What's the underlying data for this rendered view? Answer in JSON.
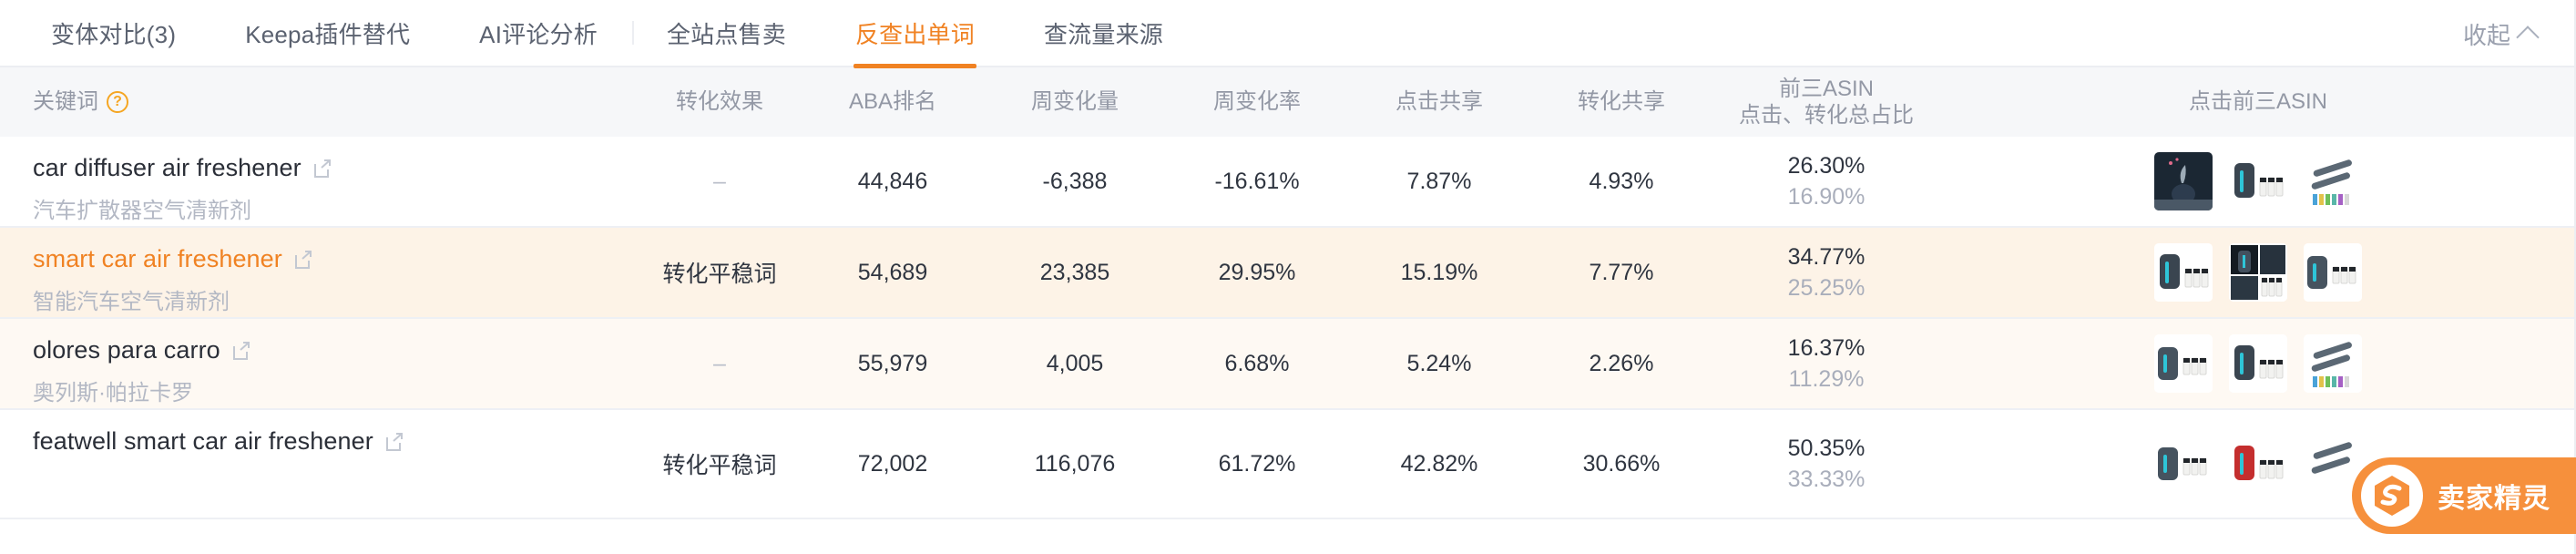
{
  "tabs": [
    {
      "label": "变体对比(3)",
      "active": false
    },
    {
      "label": "Keepa插件替代",
      "active": false
    },
    {
      "label": "AI评论分析",
      "active": false
    },
    {
      "label": "全站点售卖",
      "active": false
    },
    {
      "label": "反查出单词",
      "active": true
    },
    {
      "label": "查流量来源",
      "active": false
    }
  ],
  "collapse": {
    "label": "收起",
    "icon": "chevron-up-icon"
  },
  "table": {
    "columns": [
      {
        "key": "keyword",
        "label": "关键词",
        "help": "?",
        "align": "left"
      },
      {
        "key": "effect",
        "label": "转化效果"
      },
      {
        "key": "aba_rank",
        "label": "ABA排名"
      },
      {
        "key": "week_change",
        "label": "周变化量"
      },
      {
        "key": "week_rate",
        "label": "周变化率"
      },
      {
        "key": "click_share",
        "label": "点击共享"
      },
      {
        "key": "conv_share",
        "label": "转化共享"
      },
      {
        "key": "top3_asin",
        "label": "前三ASIN",
        "sublabel": "点击、转化总占比"
      },
      {
        "key": "top3_imgs",
        "label": "点击前三ASIN"
      }
    ],
    "rows": [
      {
        "keyword": "car diffuser air freshener",
        "keyword_cn": "汽车扩散器空气清新剂",
        "keyword_highlight": false,
        "effect": "–",
        "aba_rank": "44,846",
        "week_change": "-6,388",
        "week_rate": "-16.61%",
        "click_share": "7.87%",
        "conv_share": "4.93%",
        "top3_click": "26.30%",
        "top3_conv": "16.90%",
        "highlight": "none"
      },
      {
        "keyword": "smart car air freshener",
        "keyword_cn": "智能汽车空气清新剂",
        "keyword_highlight": true,
        "effect": "转化平稳词",
        "aba_rank": "54,689",
        "week_change": "23,385",
        "week_rate": "29.95%",
        "click_share": "15.19%",
        "conv_share": "7.77%",
        "top3_click": "34.77%",
        "top3_conv": "25.25%",
        "highlight": "strong"
      },
      {
        "keyword": "olores para carro",
        "keyword_cn": "奥列斯·帕拉卡罗",
        "keyword_highlight": false,
        "effect": "–",
        "aba_rank": "55,979",
        "week_change": "4,005",
        "week_rate": "6.68%",
        "click_share": "5.24%",
        "conv_share": "2.26%",
        "top3_click": "16.37%",
        "top3_conv": "11.29%",
        "highlight": "soft"
      },
      {
        "keyword": "featwell smart car air freshener",
        "keyword_cn": "",
        "keyword_highlight": false,
        "effect": "转化平稳词",
        "aba_rank": "72,002",
        "week_change": "116,076",
        "week_rate": "61.72%",
        "click_share": "42.82%",
        "conv_share": "30.66%",
        "top3_click": "50.35%",
        "top3_conv": "33.33%",
        "highlight": "none"
      }
    ]
  },
  "watermark": {
    "label": "卖家精灵",
    "logo": "s-logo-icon"
  },
  "colors": {
    "accent": "#f08223",
    "header_bg": "#f6f7f9",
    "row_highlight": "#fdf3e7",
    "row_highlight_soft": "#fef9f3",
    "text": "#2f3540",
    "muted": "#9398a5",
    "watermark_bg": "#f6903c"
  }
}
